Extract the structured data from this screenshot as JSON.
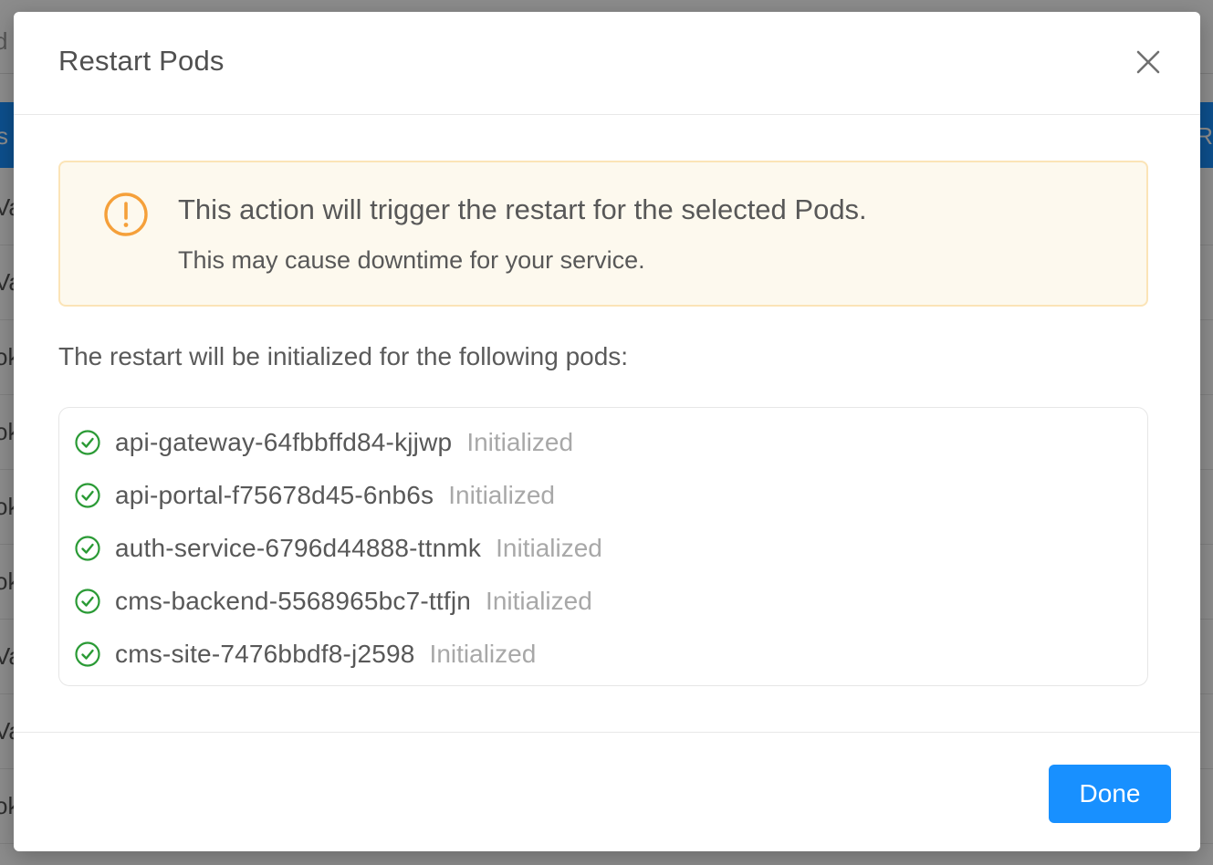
{
  "background": {
    "search_stub": "d",
    "header_left": "s",
    "header_right": "R",
    "row_stubs": [
      "Va",
      "Va",
      "ok",
      "ok",
      "ok",
      "ok",
      "Va",
      "Va",
      "ok"
    ]
  },
  "modal": {
    "title": "Restart Pods",
    "close_icon": "close-icon"
  },
  "alert": {
    "icon": "exclamation-circle-icon",
    "title": "This action will trigger the restart for the selected Pods.",
    "description": "This may cause downtime for your service.",
    "colors": {
      "background": "#fdf9ee",
      "border": "#fbe4b7",
      "icon": "#f5a03a"
    }
  },
  "intro_text": "The restart will be initialized for the following pods:",
  "pods": [
    {
      "name": "api-gateway-64fbbffd84-kjjwp",
      "status": "Initialized"
    },
    {
      "name": "api-portal-f75678d45-6nb6s",
      "status": "Initialized"
    },
    {
      "name": "auth-service-6796d44888-ttnmk",
      "status": "Initialized"
    },
    {
      "name": "cms-backend-5568965bc7-ttfjn",
      "status": "Initialized"
    },
    {
      "name": "cms-site-7476bbdf8-j2598",
      "status": "Initialized"
    }
  ],
  "status_icon": "check-circle-icon",
  "status_color": "#2a9a35",
  "footer": {
    "done_label": "Done",
    "accent": "#1890ff"
  }
}
